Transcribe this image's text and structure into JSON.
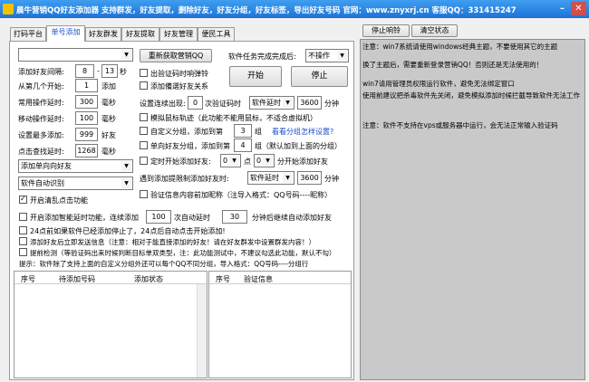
{
  "window": {
    "title": "晨牛营销QQ好友添加器 支持群发，好友提取，删除好友，好友分组，好友标签，导出好友号码  官网：www.znyxrj.cn  客服QQ：331415247",
    "min_icon": "minimize-icon",
    "close_icon": "close-icon",
    "min_glyph": "–",
    "close_glyph": "✕"
  },
  "tabs": [
    "打码平台",
    "单号添加",
    "好友群发",
    "好友提取",
    "好友管理",
    "便民工具"
  ],
  "active_tab": "单号添加",
  "left": {
    "account_select": "",
    "interval_label": "添加好友间隔:",
    "interval_from": "8",
    "interval_sep": "-",
    "interval_to": "13",
    "interval_unit": "秒",
    "start_label": "从第几个开始:",
    "start_value": "1",
    "start_unit": "添加",
    "common_delay_label": "常用操作延时:",
    "common_delay": "300",
    "common_delay_unit": "毫秒",
    "move_delay_label": "移动操作延时:",
    "move_delay": "100",
    "move_delay_unit": "毫秒",
    "max_add_label": "设置最多添加:",
    "max_add": "999",
    "max_add_unit": "好友",
    "click_delay_label": "点击查找延时:",
    "click_delay": "1268",
    "click_delay_unit": "毫秒",
    "mode_select": "添加单向向好友",
    "verify_select": "软件自动识别",
    "clear_click_label": "开启清乱点击功能"
  },
  "middle": {
    "refresh_button": "重新获取营销QQ",
    "opt_verify_pause": "出验证码时响弹铃",
    "opt_add_remark": "添加備選好友关系",
    "captcha_label": "设置连续出现:",
    "captcha_times": "0",
    "captcha_unit_1": "次验证码时",
    "captcha_action": "软件延时",
    "captcha_seconds": "3600",
    "captcha_unit_2": "分钟",
    "opt_simulate": "模拟鼠标轨迹（此功能不能用鼠标，不适合虚拟机）",
    "opt_custom_group": "自定义分组，添加到第",
    "custom_group_no": "3",
    "custom_group_unit": "组",
    "how_group_link": "看看分组怎样设置?",
    "opt_single_group": "单向好友分组，添加到第",
    "single_group_no": "4",
    "single_group_unit": "组（默认加到上面的分组）",
    "opt_timed": "定时开始添加好友:",
    "timed_hour": "0",
    "timed_dot": "点",
    "timed_min": "0",
    "timed_unit": "分开始添加好友",
    "limit_label": "遇到添加提限制添加好友时:",
    "limit_action": "软件延时",
    "limit_minutes": "3600",
    "limit_unit": "分钟",
    "opt_verify_msg": "验证信息内容前加昵称（注导入格式：QQ号码----昵称）"
  },
  "controls": {
    "task_done_label": "软件任务完成完成后:",
    "task_done_select": "不操作",
    "start_button": "开始",
    "stop_button": "停止"
  },
  "bottom_opts": {
    "smart_delay_label": "开启添加智能延时功能，连续添加",
    "smart_count": "100",
    "smart_mid": "次自动延时",
    "smart_minutes": "30",
    "smart_tail": "分钟后继续自动添加好友",
    "notice_24": "24点前如果软件已经添加停止了，24点后自动点击开始添加!",
    "notice_send": "添加好友后立即发送信息（注意：相对于能直接添加的好友！请在好友群发中设置群发内容！）",
    "notice_detect": "提前检测（等验证码出来时候判断目标单双类型，注：此功能测试中，不建议勾选此功能，默认不勾）",
    "hint": "提示：软件除了支持上面的自定义分组外还可以每个QQ不同分组，导入格式：QQ号码----分组行"
  },
  "grid_left": {
    "headers": [
      "序号",
      "待添加号码",
      "添加状态"
    ]
  },
  "grid_right": {
    "headers": [
      "序号",
      "验证信息"
    ]
  },
  "right_panel": {
    "stop_button": "停止响铃",
    "clear_button": "清空状态",
    "notes": [
      "注意：win7系统请使用windows经典主题，不要使用其它的主题",
      "换了主题后，需要重新登录营销QQ！否则还是无法使用的！",
      "win7请用管理员权限运行软件，避免无法绑定窗口",
      "使用前建议把杀毒软件先关闭，避免模拟添加时候拦截导致软件无法工作",
      "注意：软件不支持在vps或服务器中运行，会无法正常输入验证码"
    ]
  }
}
